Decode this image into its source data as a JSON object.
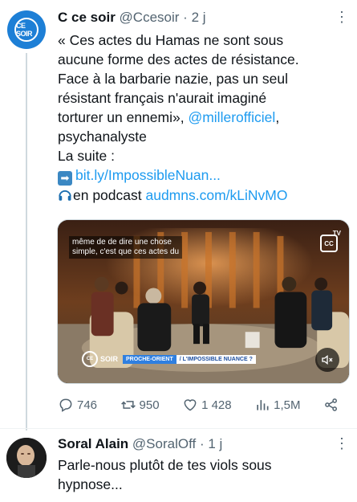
{
  "tweets": [
    {
      "author_name": "C ce soir",
      "handle": "@Ccesoir",
      "separator": "·",
      "time": "2 j",
      "avatar_logo_text": "CE SOIR",
      "lines": [
        "« Ces actes du Hamas ne sont sous",
        "aucune forme des actes de résistance.",
        "Face à la barbarie nazie, pas un seul",
        "résistant français n'aurait imaginé",
        "torturer un ennemi», "
      ],
      "mention": "@millerofficiel",
      "after_mention": ",",
      "line_last": "psychanalyste",
      "suite_label": "La suite :",
      "link1_icon": "right-arrow-emoji",
      "link1": "bit.ly/ImpossibleNuan...",
      "podcast_icon": "headphones-emoji",
      "podcast_label": "en podcast ",
      "link2": "audmns.com/kLiNvMO",
      "media": {
        "caption_line1": "même de de dire une chose",
        "caption_line2": "simple, c'est que ces actes du",
        "cc_label": "CC",
        "tv_label": "TV",
        "brand_logo": "CE",
        "brand_text": "SOIR",
        "tag1": "PROCHE-ORIENT",
        "tag2": "/ L'IMPOSSIBLE NUANCE ?",
        "mute_icon": "speaker-muted-icon"
      },
      "actions": {
        "replies": "746",
        "reposts": "950",
        "likes": "1 428",
        "views": "1,5M"
      }
    },
    {
      "author_name": "Soral Alain",
      "handle": "@SoralOff",
      "separator": "·",
      "time": "1 j",
      "lines": [
        "Parle-nous plutôt de tes viols sous",
        "hypnose..."
      ]
    }
  ],
  "colors": {
    "link": "#1d9bf0",
    "secondary_text": "#536471",
    "primary_text": "#0f1419",
    "avatar_blue": "#1d7fd6",
    "thread_line": "#cfd9de"
  }
}
